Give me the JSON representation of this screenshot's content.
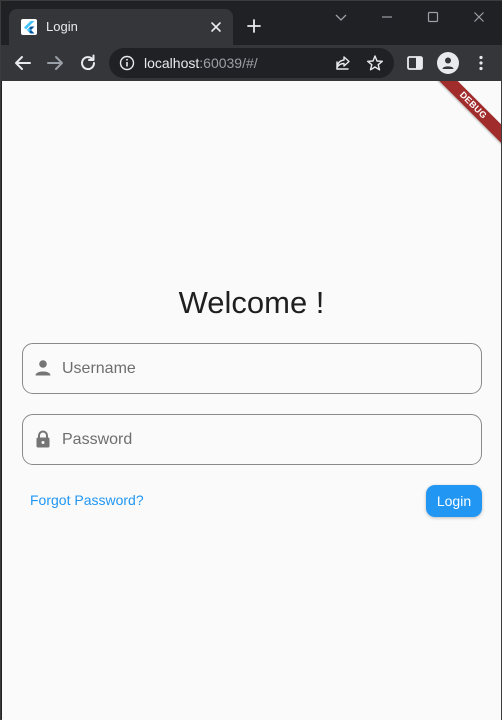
{
  "browser": {
    "tab": {
      "title": "Login",
      "favicon": "flutter-logo-icon",
      "close_icon": "close-icon"
    },
    "new_tab_icon": "plus-icon",
    "window_controls": [
      "chevron-down-icon",
      "minimize-icon",
      "maximize-icon",
      "close-icon"
    ],
    "toolbar": {
      "back_icon": "arrow-left-icon",
      "forward_icon": "arrow-right-icon",
      "reload_icon": "reload-icon",
      "url_host": "localhost",
      "url_rest": ":60039/#/",
      "info_icon": "info-icon",
      "share_icon": "share-icon",
      "bookmark_icon": "star-icon",
      "side_panel_icon": "side-panel-icon",
      "profile_icon": "person-icon",
      "menu_icon": "more-vert-icon"
    }
  },
  "page": {
    "debug_banner": "DEBUG",
    "title": "Welcome !",
    "username": {
      "placeholder": "Username",
      "value": "",
      "icon": "person-icon"
    },
    "password": {
      "placeholder": "Password",
      "value": "",
      "icon": "lock-icon"
    },
    "forgot_password_label": "Forgot Password?",
    "login_label": "Login"
  },
  "colors": {
    "accent": "#2196f3",
    "debug_banner": "#a12c2c",
    "page_background": "#fafafa",
    "browser_frame": "#202124",
    "toolbar": "#35363a"
  }
}
